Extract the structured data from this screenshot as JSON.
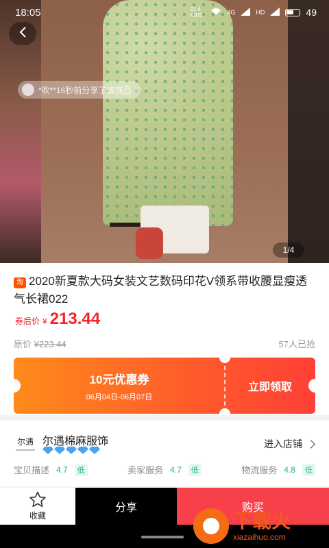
{
  "status_bar": {
    "time": "18:05",
    "net_speed": "21.4 KB/S",
    "signal_1": "4G",
    "signal_2": "HD",
    "battery": "49"
  },
  "hero": {
    "share_notice": "*吹**16秒前分享了该商品",
    "page_indicator": "1/4"
  },
  "product": {
    "source_badge": "淘",
    "title": "2020新夏款大码女装文艺数码印花V领系带收腰显瘦透气长裙022",
    "price_label": "券后价",
    "price_currency": "¥",
    "price_value": "213.44",
    "original_label": "原价",
    "original_price": "¥223.44",
    "sold_count": "57人已抢"
  },
  "coupon": {
    "amount": "10元优惠券",
    "date_range": "06月04日-06月07日",
    "get_label": "立即领取"
  },
  "shop": {
    "logo_text": "尔遇",
    "name": "尔遇棉麻服饰",
    "enter_label": "进入店铺",
    "scores": [
      {
        "label": "宝贝描述",
        "value": "4.7",
        "level": "低"
      },
      {
        "label": "卖家服务",
        "value": "4.7",
        "level": "低"
      },
      {
        "label": "物流服务",
        "value": "4.8",
        "level": "低"
      }
    ]
  },
  "bottom_bar": {
    "favorite_label": "收藏",
    "share_label": "分享",
    "buy_label": "购买"
  },
  "watermark": {
    "cn": "下载火",
    "en": "xiazaihuo.com"
  },
  "colors": {
    "price_red": "#f5222d",
    "coupon_orange": "#ff8b1a",
    "coupon_red": "#ff4036",
    "buy_red": "#f8404a",
    "score_green": "#1fb58a",
    "diamond_blue": "#4aa3f0"
  }
}
